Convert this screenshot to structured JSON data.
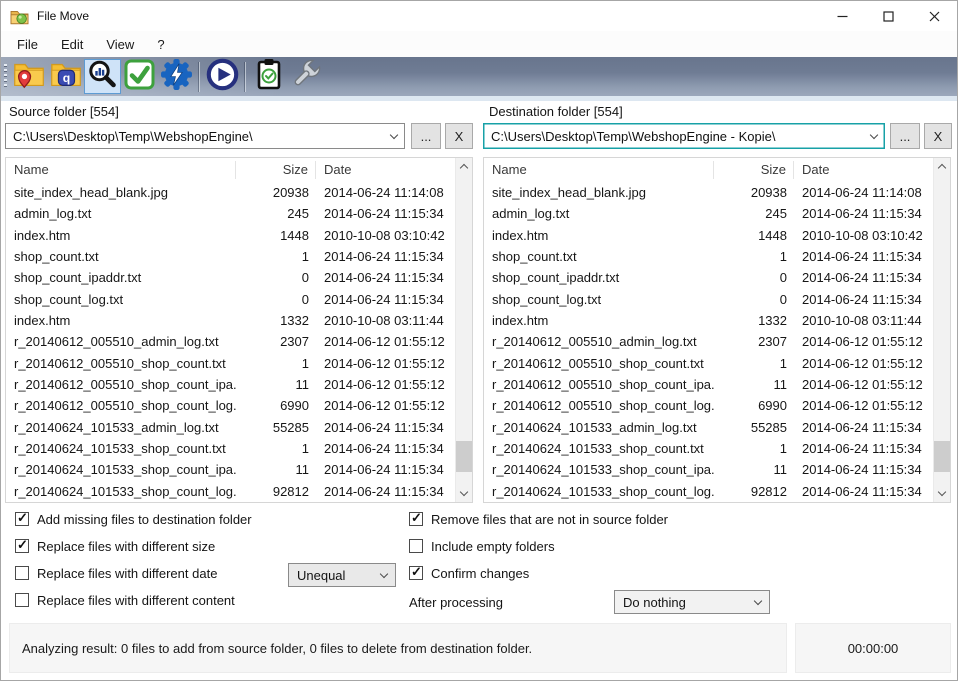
{
  "window": {
    "title": "File Move",
    "controls": [
      "minimize",
      "maximize",
      "close"
    ]
  },
  "menu": {
    "items": [
      "File",
      "Edit",
      "View",
      "?"
    ]
  },
  "toolbar": {
    "icons": [
      "folder-pin-icon",
      "folder-question-icon",
      "magnifier-chart-icon",
      "green-check-icon",
      "gear-lightning-icon",
      "play-icon",
      "clipboard-check-icon",
      "wrench-icon"
    ],
    "selected_icon": "magnifier-chart-icon"
  },
  "colors": {
    "focus_border": "#17a1a7",
    "toolbar_selected_bg": "#cfe3f8",
    "toolbar_selected_border": "#5d9bd3"
  },
  "source_panel": {
    "label": "Source folder [554]",
    "path": "C:\\Users\\Desktop\\Temp\\WebshopEngine\\",
    "browse_label": "...",
    "clear_label": "X",
    "columns": [
      "Name",
      "Size",
      "Date"
    ],
    "files": [
      {
        "name": "site_index_head_blank.jpg",
        "size": "20938",
        "date": "2014-06-24 11:14:08"
      },
      {
        "name": "admin_log.txt",
        "size": "245",
        "date": "2014-06-24 11:15:34"
      },
      {
        "name": "index.htm",
        "size": "1448",
        "date": "2010-10-08 03:10:42"
      },
      {
        "name": "shop_count.txt",
        "size": "1",
        "date": "2014-06-24 11:15:34"
      },
      {
        "name": "shop_count_ipaddr.txt",
        "size": "0",
        "date": "2014-06-24 11:15:34"
      },
      {
        "name": "shop_count_log.txt",
        "size": "0",
        "date": "2014-06-24 11:15:34"
      },
      {
        "name": "index.htm",
        "size": "1332",
        "date": "2010-10-08 03:11:44"
      },
      {
        "name": "r_20140612_005510_admin_log.txt",
        "size": "2307",
        "date": "2014-06-12 01:55:12"
      },
      {
        "name": "r_20140612_005510_shop_count.txt",
        "size": "1",
        "date": "2014-06-12 01:55:12"
      },
      {
        "name": "r_20140612_005510_shop_count_ipa...",
        "size": "11",
        "date": "2014-06-12 01:55:12"
      },
      {
        "name": "r_20140612_005510_shop_count_log...",
        "size": "6990",
        "date": "2014-06-12 01:55:12"
      },
      {
        "name": "r_20140624_101533_admin_log.txt",
        "size": "55285",
        "date": "2014-06-24 11:15:34"
      },
      {
        "name": "r_20140624_101533_shop_count.txt",
        "size": "1",
        "date": "2014-06-24 11:15:34"
      },
      {
        "name": "r_20140624_101533_shop_count_ipa...",
        "size": "11",
        "date": "2014-06-24 11:15:34"
      },
      {
        "name": "r_20140624_101533_shop_count_log...",
        "size": "92812",
        "date": "2014-06-24 11:15:34"
      }
    ]
  },
  "destination_panel": {
    "label": "Destination folder [554]",
    "path": "C:\\Users\\Desktop\\Temp\\WebshopEngine - Kopie\\",
    "browse_label": "...",
    "clear_label": "X",
    "columns": [
      "Name",
      "Size",
      "Date"
    ],
    "files": [
      {
        "name": "site_index_head_blank.jpg",
        "size": "20938",
        "date": "2014-06-24 11:14:08"
      },
      {
        "name": "admin_log.txt",
        "size": "245",
        "date": "2014-06-24 11:15:34"
      },
      {
        "name": "index.htm",
        "size": "1448",
        "date": "2010-10-08 03:10:42"
      },
      {
        "name": "shop_count.txt",
        "size": "1",
        "date": "2014-06-24 11:15:34"
      },
      {
        "name": "shop_count_ipaddr.txt",
        "size": "0",
        "date": "2014-06-24 11:15:34"
      },
      {
        "name": "shop_count_log.txt",
        "size": "0",
        "date": "2014-06-24 11:15:34"
      },
      {
        "name": "index.htm",
        "size": "1332",
        "date": "2010-10-08 03:11:44"
      },
      {
        "name": "r_20140612_005510_admin_log.txt",
        "size": "2307",
        "date": "2014-06-12 01:55:12"
      },
      {
        "name": "r_20140612_005510_shop_count.txt",
        "size": "1",
        "date": "2014-06-12 01:55:12"
      },
      {
        "name": "r_20140612_005510_shop_count_ipa...",
        "size": "11",
        "date": "2014-06-12 01:55:12"
      },
      {
        "name": "r_20140612_005510_shop_count_log...",
        "size": "6990",
        "date": "2014-06-12 01:55:12"
      },
      {
        "name": "r_20140624_101533_admin_log.txt",
        "size": "55285",
        "date": "2014-06-24 11:15:34"
      },
      {
        "name": "r_20140624_101533_shop_count.txt",
        "size": "1",
        "date": "2014-06-24 11:15:34"
      },
      {
        "name": "r_20140624_101533_shop_count_ipa...",
        "size": "11",
        "date": "2014-06-24 11:15:34"
      },
      {
        "name": "r_20140624_101533_shop_count_log...",
        "size": "92812",
        "date": "2014-06-24 11:15:34"
      }
    ]
  },
  "options": {
    "left": [
      {
        "label": "Add missing files to destination folder",
        "checked": true
      },
      {
        "label": "Replace files with different size",
        "checked": true
      },
      {
        "label": "Replace files with different date",
        "checked": false
      },
      {
        "label": "Replace files with different content",
        "checked": false
      }
    ],
    "right": [
      {
        "label": "Remove files that are not in source folder",
        "checked": true
      },
      {
        "label": "Include empty folders",
        "checked": false
      },
      {
        "label": "Confirm changes",
        "checked": true
      }
    ],
    "date_compare_value": "Unequal",
    "after_processing_label": "After processing",
    "after_processing_value": "Do nothing"
  },
  "status": {
    "message": "Analyzing result: 0 files to add from source folder, 0 files to delete from destination folder.",
    "timer": "00:00:00"
  }
}
